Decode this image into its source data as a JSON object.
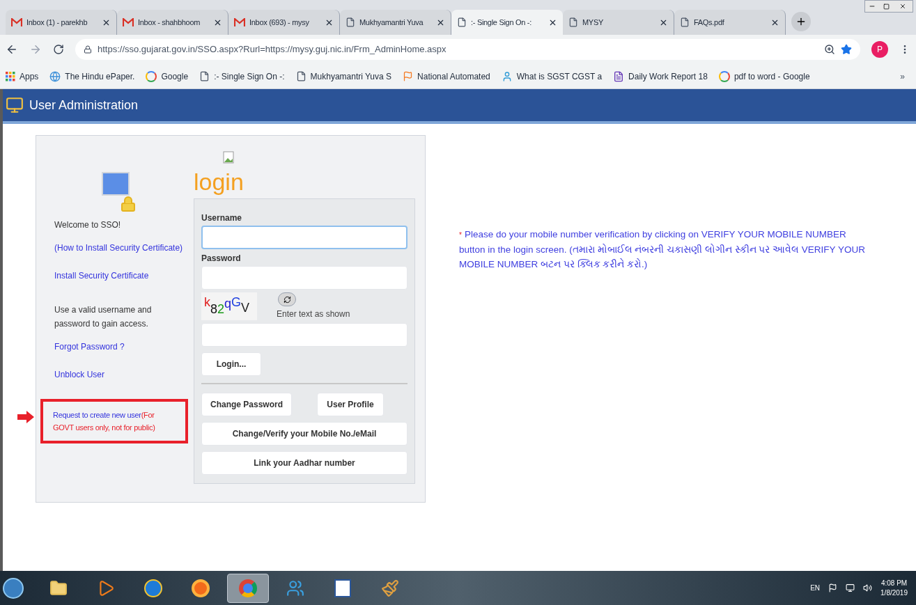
{
  "browser": {
    "tabs": [
      {
        "kind": "mail",
        "label": "Inbox (1) - parekhb",
        "selected": false
      },
      {
        "kind": "mail",
        "label": "Inbox - shahbhoom",
        "selected": false
      },
      {
        "kind": "mail",
        "label": "Inbox (693) - mysy",
        "selected": false
      },
      {
        "kind": "page",
        "label": "Mukhyamantri Yuva",
        "selected": false
      },
      {
        "kind": "page",
        "label": ":- Single Sign On -:",
        "selected": true
      },
      {
        "kind": "page",
        "label": "MYSY",
        "selected": false
      },
      {
        "kind": "page",
        "label": "FAQs.pdf",
        "selected": false
      }
    ],
    "address": "https://sso.gujarat.gov.in/SSO.aspx?Rurl=https://mysy.guj.nic.in/Frm_AdminHome.aspx",
    "profile_initial": "P",
    "bookmarks": [
      {
        "kind": "apps",
        "label": "Apps"
      },
      {
        "kind": "globe",
        "label": "The Hindu ePaper."
      },
      {
        "kind": "google",
        "label": "Google"
      },
      {
        "kind": "page",
        "label": ":- Single Sign On -:"
      },
      {
        "kind": "page",
        "label": "Mukhyamantri Yuva S"
      },
      {
        "kind": "flag",
        "label": "National Automated"
      },
      {
        "kind": "person",
        "label": "What is SGST CGST a"
      },
      {
        "kind": "form",
        "label": "Daily Work Report 18"
      },
      {
        "kind": "google",
        "label": "pdf to word - Google"
      }
    ],
    "bookmarks_more": "»"
  },
  "header": {
    "title": "User Administration"
  },
  "left_panel": {
    "items": [
      {
        "kind": "text",
        "text": "Welcome to SSO!"
      },
      {
        "kind": "link",
        "text": "(How to Install Security Certificate)"
      },
      {
        "kind": "link",
        "text": "Install Security Certificate"
      },
      {
        "kind": "text",
        "text": "Use a valid username and password to gain access."
      },
      {
        "kind": "link",
        "text": "Forgot Password ?"
      },
      {
        "kind": "link",
        "text": "Unblock User"
      },
      {
        "kind": "request",
        "text": "Request to create new user",
        "note": "(For GOVT users only, not for public)",
        "highlighted": true
      }
    ]
  },
  "login": {
    "title": "login",
    "username_label": "Username",
    "password_label": "Password",
    "captcha": "k82qGV",
    "captcha_hint": "Enter text as shown",
    "login_button": "Login...",
    "buttons": [
      {
        "kind": "half",
        "label": "Change Password"
      },
      {
        "kind": "half",
        "label": "User Profile"
      },
      {
        "kind": "full",
        "label": "Change/Verify your Mobile No./eMail"
      },
      {
        "kind": "full",
        "label": "Link your Aadhar number"
      }
    ]
  },
  "notice": {
    "marker": "*",
    "text": "Please do your mobile number verification by clicking on VERIFY YOUR MOBILE NUMBER button in the login screen. (તમારા મોબાઈલ નંબરની ચકાસણી લોગીન સ્કીન પર આવેલ VERIFY YOUR MOBILE NUMBER બટન પર ક્લિક કરીને કરો.)"
  },
  "taskbar": {
    "apps": [
      {
        "kind": "folder",
        "selected": false
      },
      {
        "kind": "player",
        "selected": false
      },
      {
        "kind": "ie",
        "selected": false
      },
      {
        "kind": "firefox",
        "selected": false
      },
      {
        "kind": "chrome",
        "selected": true
      },
      {
        "kind": "people",
        "selected": false
      },
      {
        "kind": "word",
        "selected": false
      },
      {
        "kind": "paint",
        "selected": false
      }
    ],
    "language": "EN",
    "time": "4:08 PM",
    "date": "1/8/2019"
  }
}
